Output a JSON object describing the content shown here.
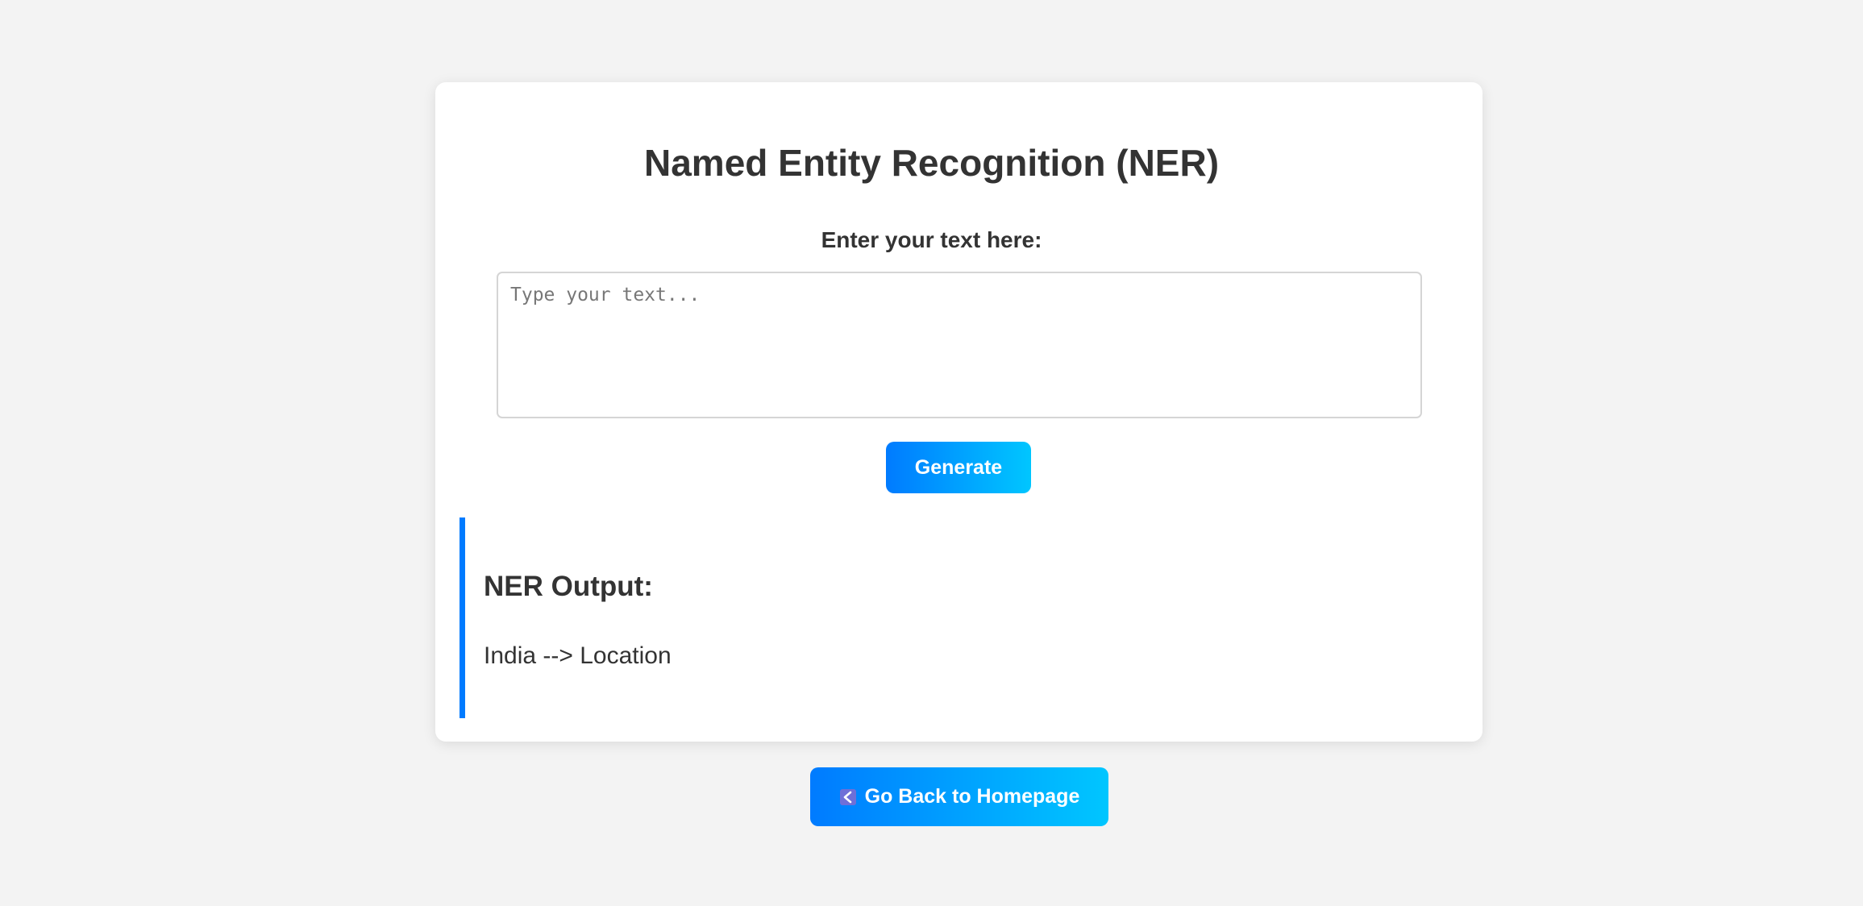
{
  "header": {
    "title": "Named Entity Recognition (NER)"
  },
  "form": {
    "label": "Enter your text here:",
    "input_value": "",
    "input_placeholder": "Type your text...",
    "generate_label": "Generate"
  },
  "output": {
    "heading": "NER Output:",
    "results": [
      "India --> Location"
    ]
  },
  "footer": {
    "home_label": "Go Back to Homepage",
    "home_icon": "back-arrow-icon"
  },
  "colors": {
    "background": "#f3f3f3",
    "card": "#ffffff",
    "accent": "#007bff",
    "accent_end": "#00c6ff",
    "text": "#333333"
  }
}
